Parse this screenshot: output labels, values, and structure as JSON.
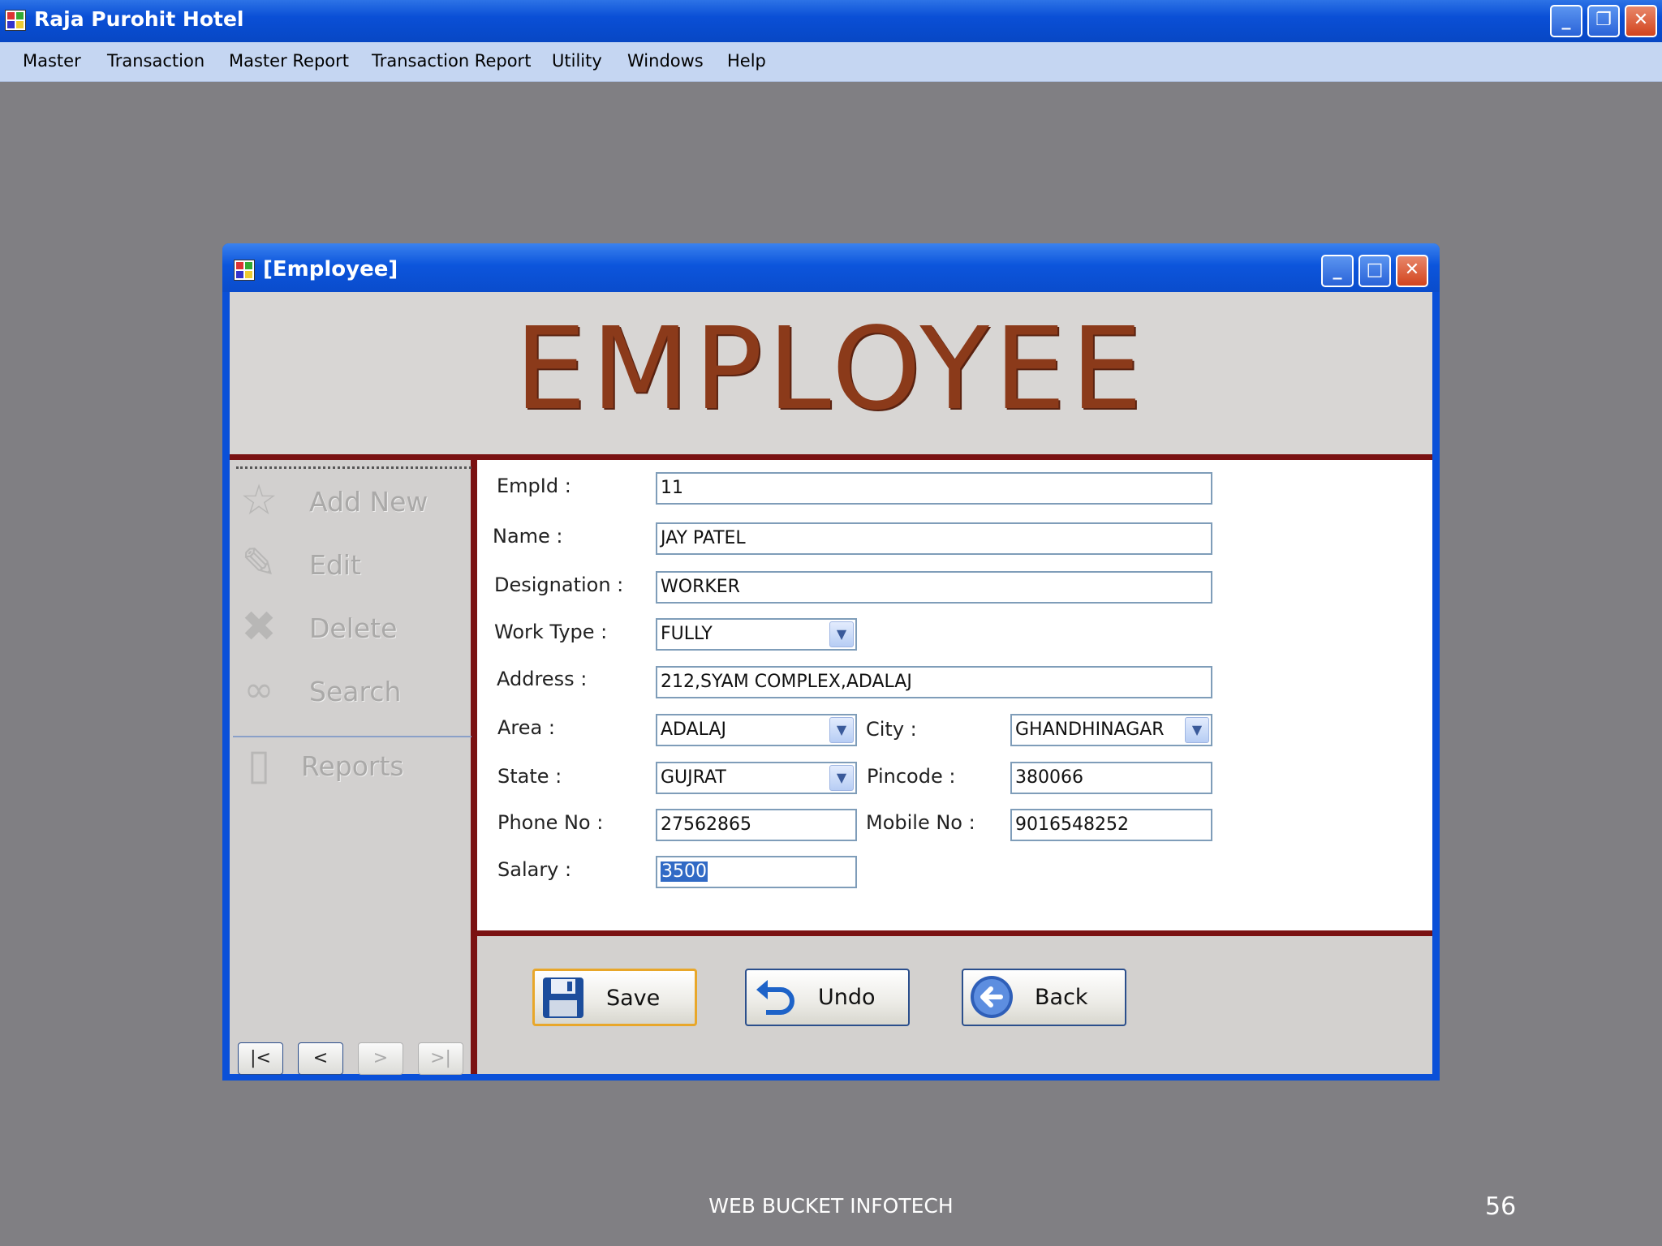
{
  "app": {
    "title": "Raja Purohit Hotel"
  },
  "menu": [
    "Master",
    "Transaction",
    "Master Report",
    "Transaction Report",
    "Utility",
    "Windows",
    "Help"
  ],
  "window": {
    "title": "[Employee]",
    "banner": "EMPLOYEE"
  },
  "sidebar": {
    "items": [
      {
        "label": "Add New",
        "icon": "star-icon"
      },
      {
        "label": "Edit",
        "icon": "edit-icon"
      },
      {
        "label": "Delete",
        "icon": "delete-x-icon"
      },
      {
        "label": "Search",
        "icon": "binoculars-icon"
      },
      {
        "label": "Reports",
        "icon": "reports-icon"
      }
    ],
    "nav": [
      "|<",
      "<",
      ">",
      ">|"
    ]
  },
  "form": {
    "empid": {
      "label": "EmpId :",
      "value": "11"
    },
    "name": {
      "label": "Name :",
      "value": "JAY PATEL"
    },
    "designation": {
      "label": "Designation :",
      "value": "WORKER"
    },
    "work_type": {
      "label": "Work Type :",
      "value": "FULLY"
    },
    "address": {
      "label": "Address :",
      "value": "212,SYAM COMPLEX,ADALAJ"
    },
    "area": {
      "label": "Area :",
      "value": "ADALAJ"
    },
    "city": {
      "label": "City :",
      "value": "GHANDHINAGAR"
    },
    "state": {
      "label": "State :",
      "value": "GUJRAT"
    },
    "pincode": {
      "label": "Pincode :",
      "value": "380066"
    },
    "phone": {
      "label": "Phone No :",
      "value": "27562865"
    },
    "mobile": {
      "label": "Mobile No :",
      "value": "9016548252"
    },
    "salary": {
      "label": "Salary :",
      "value": "3500"
    }
  },
  "actions": {
    "save": "Save",
    "undo": "Undo",
    "back": "Back"
  },
  "footer": {
    "text": "WEB BUCKET INFOTECH",
    "page": "56"
  },
  "colors": {
    "titlebar": "#0a4fd6",
    "banner_text": "#8b3a1a",
    "divider": "#7a1212",
    "background": "#807f83"
  }
}
